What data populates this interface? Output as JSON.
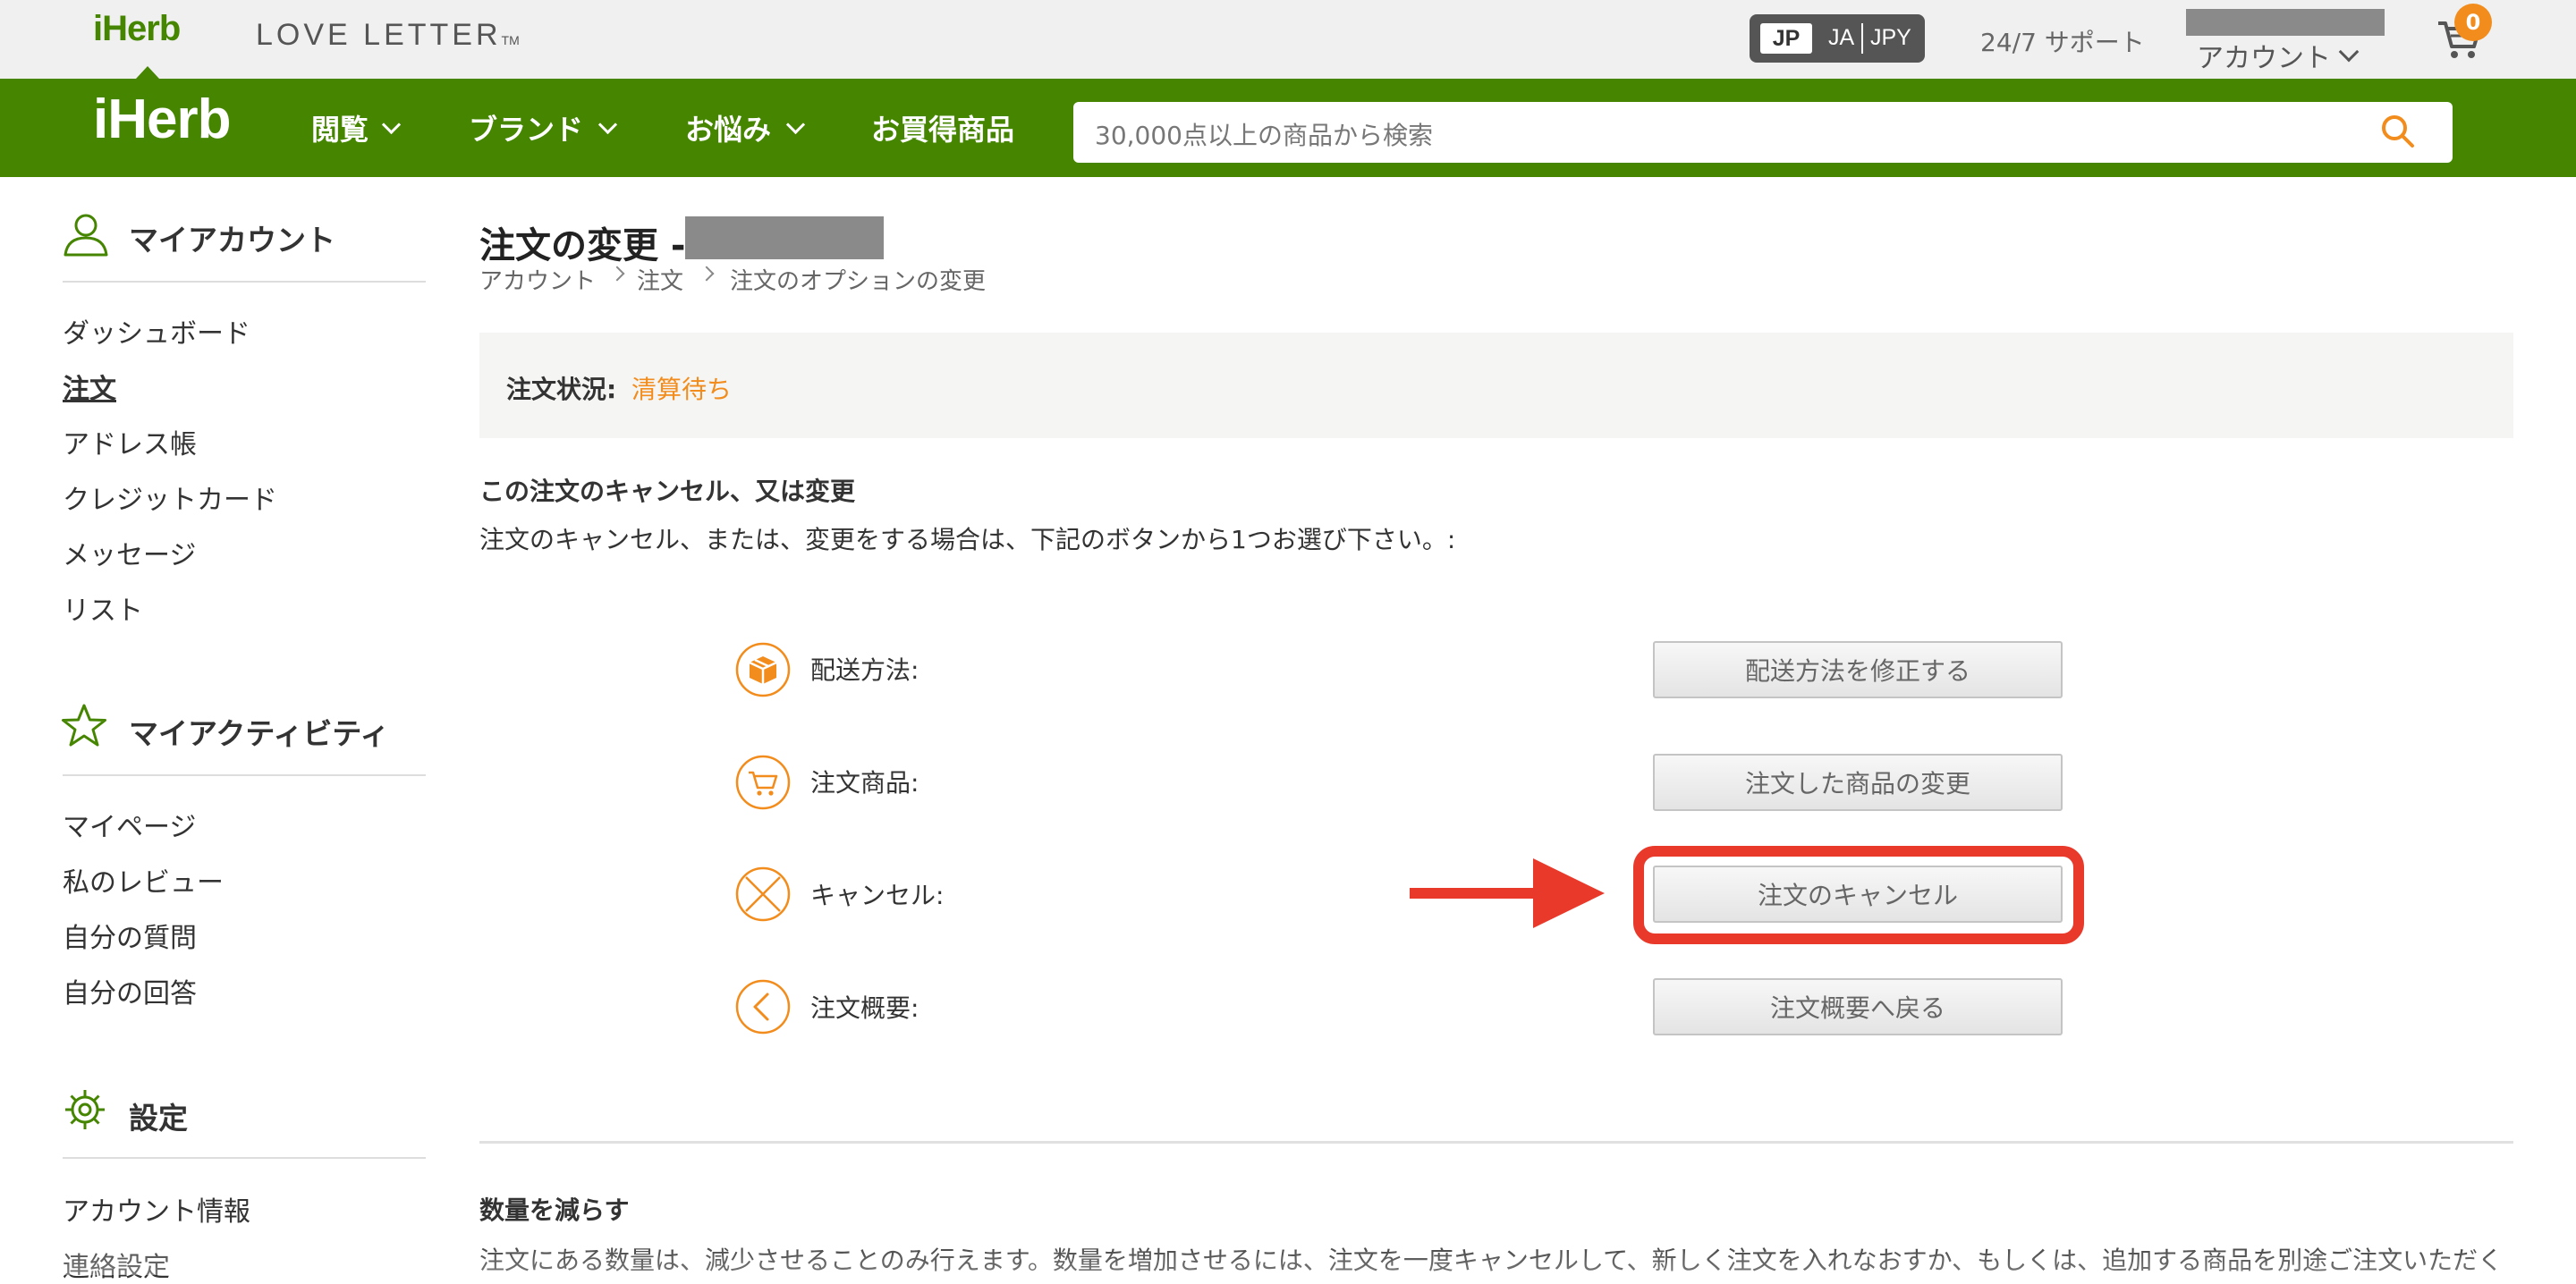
{
  "topbar": {
    "logo": "iHerb",
    "love_letter": "LOVE LETTER",
    "love_letter_mark": "TM",
    "locale": {
      "country": "JP",
      "language": "JA",
      "currency": "JPY"
    },
    "support": "24/7 サポート",
    "account": "アカウント",
    "cart_count": "0"
  },
  "nav": {
    "logo": "iHerb",
    "items": [
      {
        "label": "閲覧"
      },
      {
        "label": "ブランド"
      },
      {
        "label": "お悩み"
      },
      {
        "label": "お買得商品"
      }
    ],
    "search_placeholder": "30,000点以上の商品から検索"
  },
  "sidebar": {
    "my_account": {
      "heading": "マイアカウント",
      "items": [
        "ダッシュボード",
        "注文",
        "アドレス帳",
        "クレジットカード",
        "メッセージ",
        "リスト"
      ],
      "active": "注文"
    },
    "my_activity": {
      "heading": "マイアクティビティ",
      "items": [
        "マイページ",
        "私のレビュー",
        "自分の質問",
        "自分の回答"
      ]
    },
    "settings": {
      "heading": "設定",
      "items": [
        "アカウント情報",
        "連絡設定"
      ]
    }
  },
  "main": {
    "title": "注文の変更 -",
    "breadcrumb": [
      "アカウント",
      "注文",
      "注文のオプションの変更"
    ],
    "status_label": "注文状況:",
    "status_value": "清算待ち",
    "section_heading": "この注文のキャンセル、又は変更",
    "section_text": "注文のキャンセル、または、変更をする場合は、下記のボタンから1つお選び下さい。:",
    "options": [
      {
        "icon": "package-icon",
        "label": "配送方法:",
        "button": "配送方法を修正する"
      },
      {
        "icon": "cart-icon",
        "label": "注文商品:",
        "button": "注文した商品の変更"
      },
      {
        "icon": "cancel-x-icon",
        "label": "キャンセル:",
        "button": "注文のキャンセル"
      },
      {
        "icon": "chevron-left-icon",
        "label": "注文概要:",
        "button": "注文概要へ戻る"
      }
    ],
    "reduce_heading": "数量を減らす",
    "reduce_text": "注文にある数量は、減少させることのみ行えます。数量を増加させるには、注文を一度キャンセルして、新しく注文を入れなおすか、もしくは、追加する商品を別途ご注文いただく"
  },
  "colors": {
    "brand_green": "#458500",
    "accent_orange": "#f28c1c",
    "highlight_red": "#e8392a"
  }
}
